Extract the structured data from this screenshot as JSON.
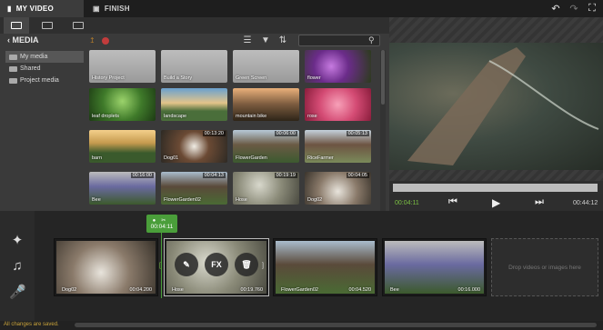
{
  "header": {
    "tabs": [
      {
        "label": "MY VIDEO",
        "icon": "film-icon"
      },
      {
        "label": "FINISH",
        "icon": "film-strip-icon"
      }
    ],
    "undo_icon": "undo-icon",
    "redo_icon": "redo-icon",
    "fullscreen_icon": "fullscreen-icon"
  },
  "media": {
    "title": "MEDIA",
    "folders": [
      {
        "label": "My media",
        "selected": true
      },
      {
        "label": "Shared",
        "selected": false
      },
      {
        "label": "Project media",
        "selected": false
      }
    ],
    "tiles": [
      {
        "label": "History Project",
        "duration": "",
        "type": "folder"
      },
      {
        "label": "Build a Story",
        "duration": "",
        "type": "folder"
      },
      {
        "label": "Green Screen",
        "duration": "",
        "type": "folder"
      },
      {
        "label": "flower",
        "duration": "",
        "type": "image"
      },
      {
        "label": "leaf droplets",
        "duration": "",
        "type": "image"
      },
      {
        "label": "landscape",
        "duration": "",
        "type": "image"
      },
      {
        "label": "mountain bike",
        "duration": "",
        "type": "image"
      },
      {
        "label": "rose",
        "duration": "",
        "type": "image"
      },
      {
        "label": "barn",
        "duration": "",
        "type": "image"
      },
      {
        "label": "Dog01",
        "duration": "00:13:20",
        "type": "video"
      },
      {
        "label": "FlowerGarden",
        "duration": "00:06:00",
        "type": "video"
      },
      {
        "label": "RiceFarmer",
        "duration": "00:05:13",
        "type": "video"
      },
      {
        "label": "Bee",
        "duration": "00:16:00",
        "type": "video"
      },
      {
        "label": "FlowerGarden02",
        "duration": "00:04:13",
        "type": "video"
      },
      {
        "label": "Hose",
        "duration": "00:19:19",
        "type": "video"
      },
      {
        "label": "Dog02",
        "duration": "00:04:05",
        "type": "video"
      }
    ]
  },
  "preview": {
    "current_time": "00:04:11",
    "total_time": "00:44:12"
  },
  "timeline": {
    "playhead_time": "00:04:11",
    "clips": [
      {
        "name": "Dog02",
        "duration": "00:04.200"
      },
      {
        "name": "Hose",
        "duration": "00:19.760"
      },
      {
        "name": "FlowerGarden02",
        "duration": "00:04.520"
      },
      {
        "name": "Bee",
        "duration": "00:16.000"
      }
    ],
    "clip_buttons": {
      "fx": "FX"
    },
    "drop_text": "Drop videos or images here"
  },
  "status": {
    "text": "All changes are saved."
  },
  "colors": {
    "accent": "#4a9e3a",
    "record": "#c23c3c"
  }
}
